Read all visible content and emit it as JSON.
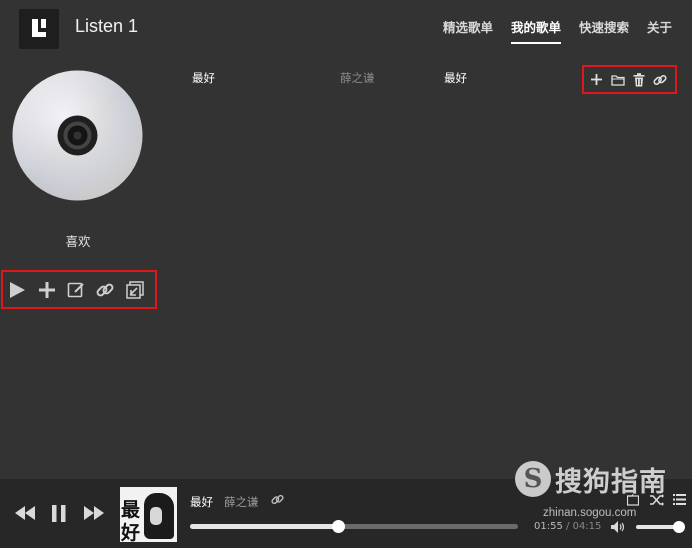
{
  "app": {
    "title": "Listen 1"
  },
  "nav": {
    "items": [
      {
        "label": "精选歌单",
        "active": false
      },
      {
        "label": "我的歌单",
        "active": true
      },
      {
        "label": "快速搜索",
        "active": false
      },
      {
        "label": "关于",
        "active": false
      }
    ]
  },
  "playlist": {
    "name": "喜欢",
    "toolbar": [
      "play-icon",
      "add-icon",
      "edit-icon",
      "link-icon",
      "export-icon"
    ]
  },
  "songs": [
    {
      "title": "最好",
      "artist": "薛之谦",
      "album": "最好"
    }
  ],
  "row_toolbar": [
    "add-icon",
    "folder-icon",
    "trash-icon",
    "link-icon"
  ],
  "player": {
    "now_playing": {
      "title": "最好",
      "artist": "薛之谦",
      "cover_text": "最好"
    },
    "current_time": "01:55",
    "separator": "/",
    "total_time": "04:15",
    "progress": 0.45,
    "volume": 1.0
  },
  "watermark": {
    "brand": "搜狗指南",
    "url": "zhinan.sogou.com"
  },
  "colors": {
    "background": "#333333",
    "player_bg": "#272727",
    "highlight_border": "#e0161b"
  }
}
